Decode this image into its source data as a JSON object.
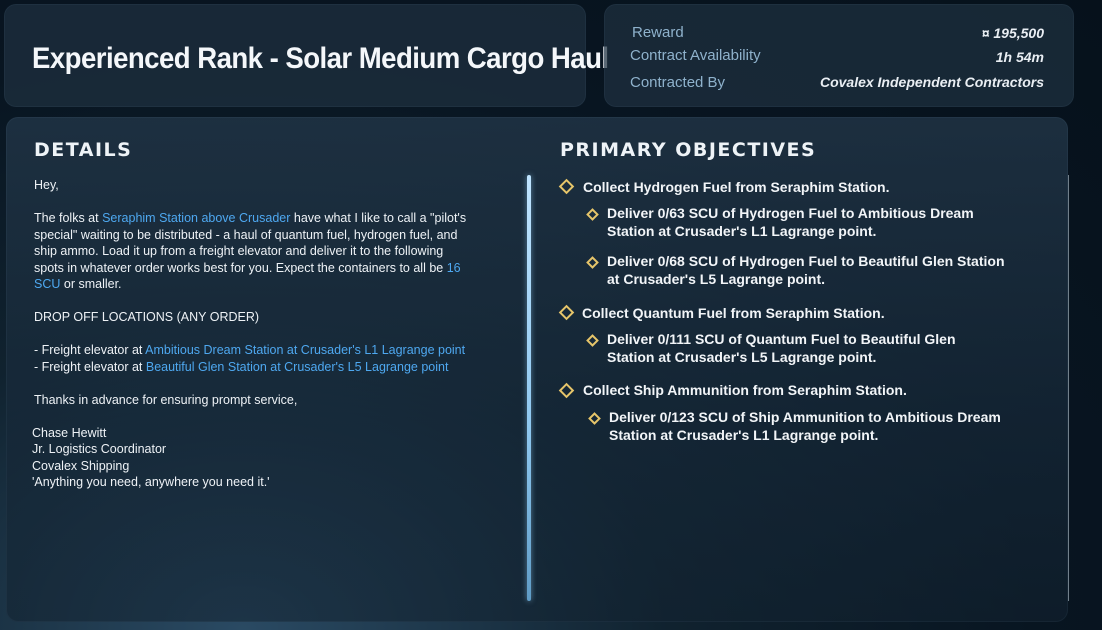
{
  "header": {
    "title": "Experienced Rank - Solar Medium Cargo Haul"
  },
  "contract_info": {
    "reward_label": "Reward",
    "reward_value": "¤ 195,500",
    "availability_label": "Contract Availability",
    "availability_value": "1h 54m",
    "contracted_by_label": "Contracted By",
    "contracted_by_value": "Covalex Independent Contractors"
  },
  "details": {
    "heading": "DETAILS",
    "greeting": "Hey,",
    "p1_a": "The folks at ",
    "p1_link1": "Seraphim Station above Crusader",
    "p1_b": " have what I like to call a \"pilot's special\" waiting to be distributed - a haul of quantum fuel, hydrogen fuel, and ship ammo. Load it up from a freight elevator and deliver it to the following spots in whatever order works best for you. Expect the containers to all be ",
    "p1_link2": "16 SCU",
    "p1_c": " or smaller.",
    "dropoff_heading": "DROP OFF LOCATIONS (ANY ORDER)",
    "loc1_prefix": "- Freight elevator at ",
    "loc1_link": "Ambitious Dream Station at Crusader's L1 Lagrange point",
    "loc2_prefix": "- Freight elevator at ",
    "loc2_link": "Beautiful Glen Station at Crusader's L5 Lagrange point",
    "thanks": "Thanks in advance for ensuring prompt service,",
    "sig_name": "Chase Hewitt",
    "sig_title": "Jr. Logistics Coordinator",
    "sig_company": "Covalex Shipping",
    "sig_motto": "'Anything you need, anywhere you need it.'"
  },
  "objectives": {
    "heading": "PRIMARY OBJECTIVES",
    "groups": [
      {
        "main": "Collect Hydrogen Fuel from Seraphim Station.",
        "subs": [
          "Deliver 0/63 SCU of Hydrogen Fuel to Ambitious Dream Station at Crusader's L1 Lagrange point.",
          "Deliver 0/68 SCU of Hydrogen Fuel to Beautiful Glen Station at Crusader's L5 Lagrange point."
        ]
      },
      {
        "main": "Collect Quantum Fuel from Seraphim Station.",
        "subs": [
          "Deliver 0/111 SCU of Quantum Fuel to Beautiful Glen Station at Crusader's L5 Lagrange point."
        ]
      },
      {
        "main": "Collect Ship Ammunition from Seraphim Station.",
        "subs": [
          "Deliver 0/123 SCU of Ship Ammunition to Ambitious Dream Station at Crusader's L1 Lagrange point."
        ]
      }
    ]
  },
  "colors": {
    "link": "#4ea8f0",
    "objective_marker": "#e6c56a",
    "label": "#8fb2cc"
  }
}
